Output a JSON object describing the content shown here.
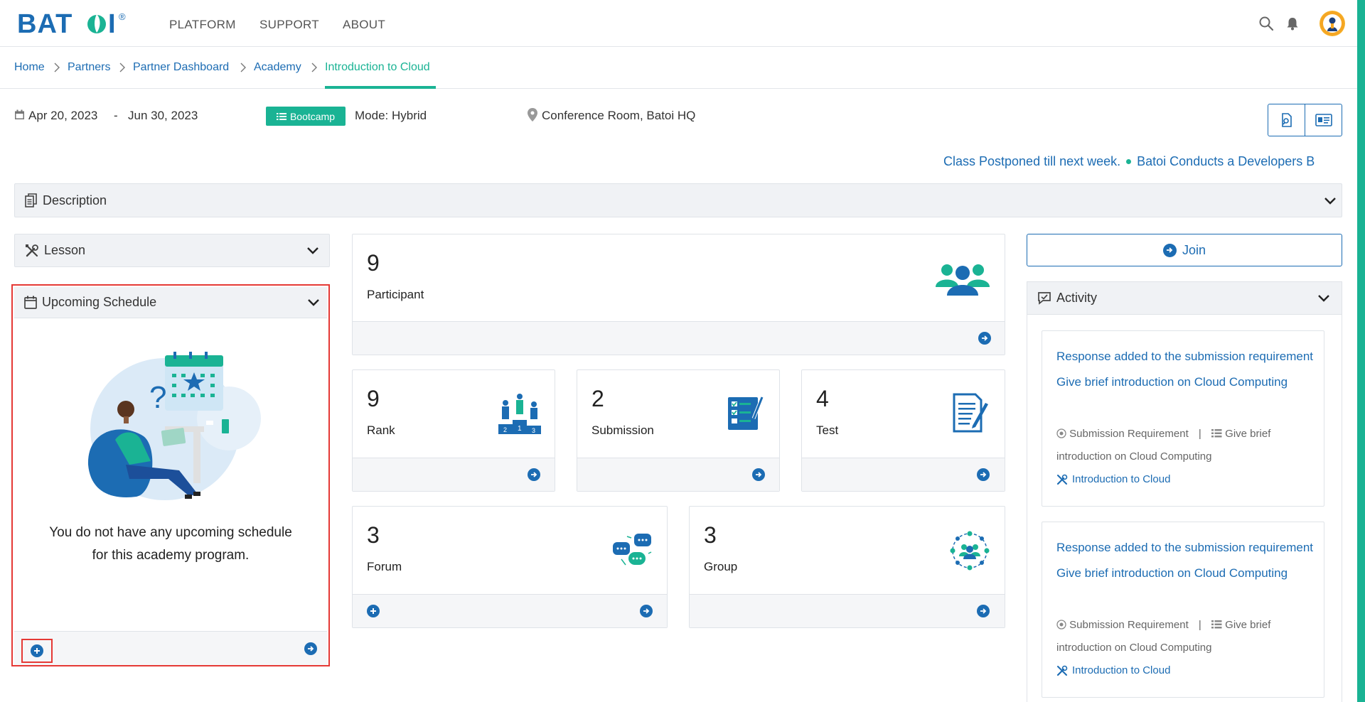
{
  "brand": {
    "logo_text": "BATOI",
    "registered": "®"
  },
  "nav": {
    "items": [
      "PLATFORM",
      "SUPPORT",
      "ABOUT"
    ]
  },
  "breadcrumb": [
    "Home",
    "Partners",
    "Partner Dashboard",
    "Academy",
    "Introduction to Cloud"
  ],
  "info": {
    "start_date": "Apr 20, 2023",
    "date_sep": "-",
    "end_date": "Jun 30, 2023",
    "type_badge": "Bootcamp",
    "mode": "Mode: Hybrid",
    "location": "Conference Room, Batoi HQ"
  },
  "ticker": [
    "Class Postponed till next week.",
    "Batoi Conducts a Developers B"
  ],
  "sections": {
    "description": "Description",
    "lesson": "Lesson",
    "upcoming": "Upcoming Schedule",
    "activity": "Activity"
  },
  "upcoming_empty": "You do not have any upcoming schedule for this academy program.",
  "stats": {
    "participant": {
      "value": "9",
      "label": "Participant"
    },
    "rank": {
      "value": "9",
      "label": "Rank"
    },
    "submission": {
      "value": "2",
      "label": "Submission"
    },
    "test": {
      "value": "4",
      "label": "Test"
    },
    "forum": {
      "value": "3",
      "label": "Forum"
    },
    "group": {
      "value": "3",
      "label": "Group"
    }
  },
  "join_label": "Join",
  "activity_items": [
    {
      "title": "Response added to the submission requirement Give brief introduction on Cloud Computing",
      "type": "Submission Requirement",
      "sep": "|",
      "item": "Give brief introduction on Cloud Computing",
      "course": "Introduction to Cloud"
    },
    {
      "title": "Response added to the submission requirement Give brief introduction on Cloud Computing",
      "type": "Submission Requirement",
      "sep": "|",
      "item": "Give brief introduction on Cloud Computing",
      "course": "Introduction to Cloud"
    }
  ],
  "colors": {
    "primary": "#1c6cb3",
    "accent": "#1ab394",
    "highlight": "#e53935"
  }
}
